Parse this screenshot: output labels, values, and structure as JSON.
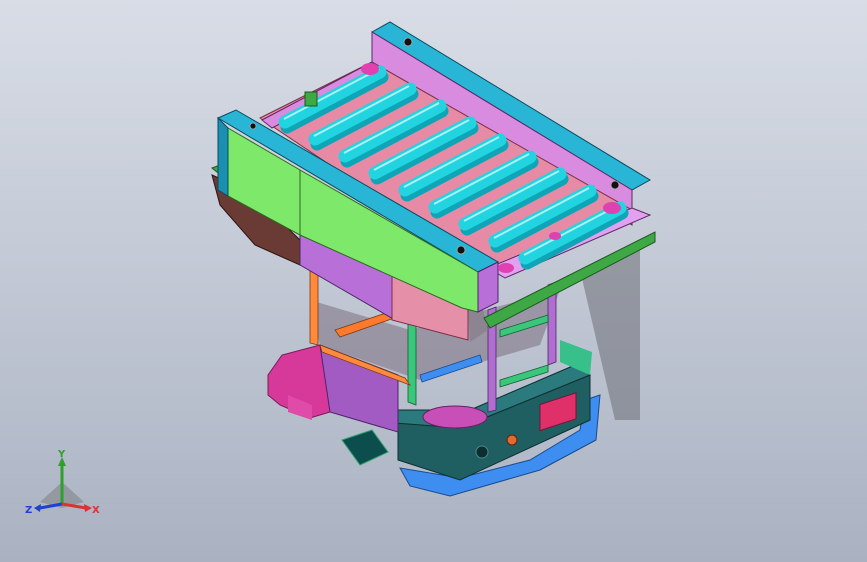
{
  "viewport": {
    "label": "",
    "background_top": "#d8dde6",
    "background_bottom": "#aab2c2"
  },
  "model": {
    "name": "",
    "colors": {
      "roller": "#22d3e0",
      "roller_shade": "#0ea5b7",
      "frame_top": "#29b6d6",
      "frame_side": "#d98be0",
      "side_panel": "#7ee86a",
      "bracket": "#b86fd8",
      "pink_panel": "#e58fa8",
      "base_teal": "#1f5f62",
      "base_magenta": "#d6399a",
      "base_blue": "#3d8ef0",
      "post_green": "#3ac77a",
      "post_orange": "#ff8a3d",
      "green_rail": "#3ea845",
      "dark_brown": "#6a3a34",
      "red_panel": "#e0306a"
    }
  },
  "triad": {
    "x_label": "X",
    "y_label": "Y",
    "z_label": "Z",
    "x_color": "#e03030",
    "y_color": "#2ea02e",
    "z_color": "#2040d0"
  }
}
